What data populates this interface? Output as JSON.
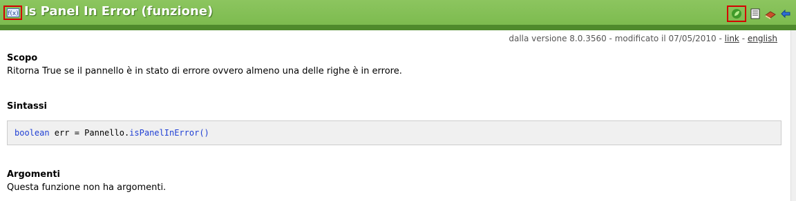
{
  "header": {
    "title": "Is Panel In Error (funzione)",
    "title_icon": "function-doc-icon",
    "toolbar": [
      {
        "name": "leaf-icon",
        "label": "",
        "highlighted": true
      },
      {
        "name": "list-icon",
        "label": ""
      },
      {
        "name": "book-icon",
        "label": ""
      },
      {
        "name": "back-arrow-icon",
        "label": ""
      }
    ]
  },
  "meta": {
    "version_text": "dalla versione 8.0.3560 - modificato il 07/05/2010 - ",
    "link_label": "link",
    "separator": " - ",
    "english_label": "english"
  },
  "sections": {
    "scopo_title": "Scopo",
    "scopo_text": "Ritorna True se il pannello è in stato di errore ovvero almeno una delle righe è in errore.",
    "sintassi_title": "Sintassi",
    "code": {
      "keyword": "boolean",
      "middle": " err = Pannello.",
      "function": "isPanelInError()"
    },
    "argomenti_title": "Argomenti",
    "argomenti_text": "Questa funzione non ha argomenti."
  },
  "colors": {
    "header_green": "#7dbb4f",
    "header_border": "#4f8a2c",
    "highlight_red": "#d40000",
    "code_blue": "#1f3fd4"
  }
}
